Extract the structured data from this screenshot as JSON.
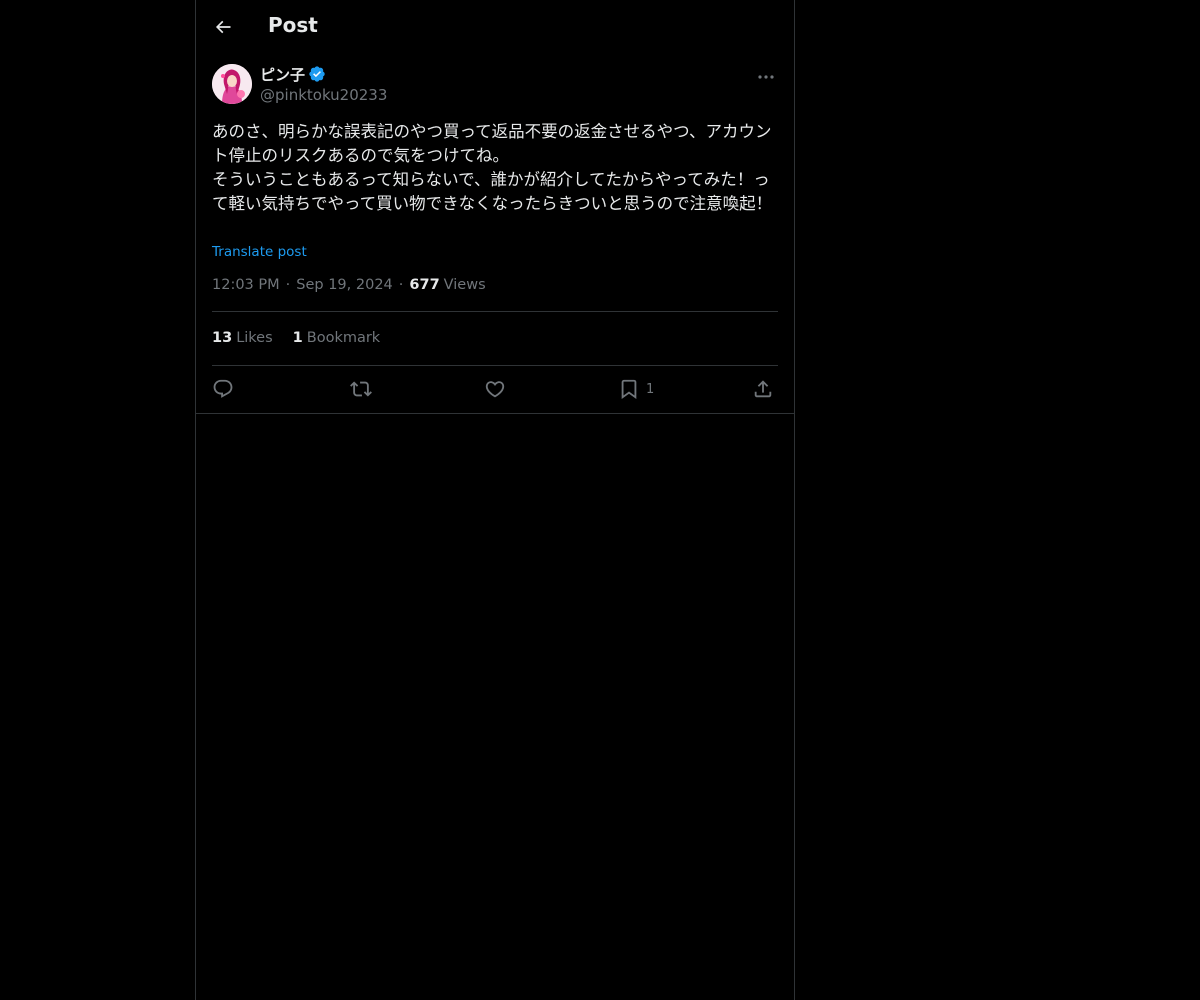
{
  "header": {
    "title": "Post",
    "back_icon": "back-arrow-icon"
  },
  "post": {
    "author": {
      "display_name": "ピン子",
      "handle": "@pinktoku20233",
      "verified": true,
      "verified_color": "#1d9bf0"
    },
    "text": "あのさ、明らかな誤表記のやつ買って返品不要の返金させるやつ、アカウント停止のリスクあるので気をつけてね。\nそういうこともあるって知らないで、誰かが紹介してたからやってみた！って軽い気持ちでやって買い物できなくなったらきついと思うので注意喚起！",
    "translate_label": "Translate post",
    "time": "12:03 PM",
    "date": "Sep 19, 2024",
    "views_count": "677",
    "views_label": "Views",
    "separator": "·"
  },
  "stats": {
    "likes_count": "13",
    "likes_label": "Likes",
    "bookmarks_count": "1",
    "bookmarks_label": "Bookmark"
  },
  "actions": {
    "reply_icon": "reply-icon",
    "repost_icon": "repost-icon",
    "like_icon": "heart-icon",
    "bookmark_icon": "bookmark-icon",
    "bookmark_count": "1",
    "share_icon": "share-icon"
  },
  "colors": {
    "background": "#000000",
    "text": "#e7e9ea",
    "secondary": "#71767b",
    "accent": "#1d9bf0",
    "border": "#2f3336"
  }
}
